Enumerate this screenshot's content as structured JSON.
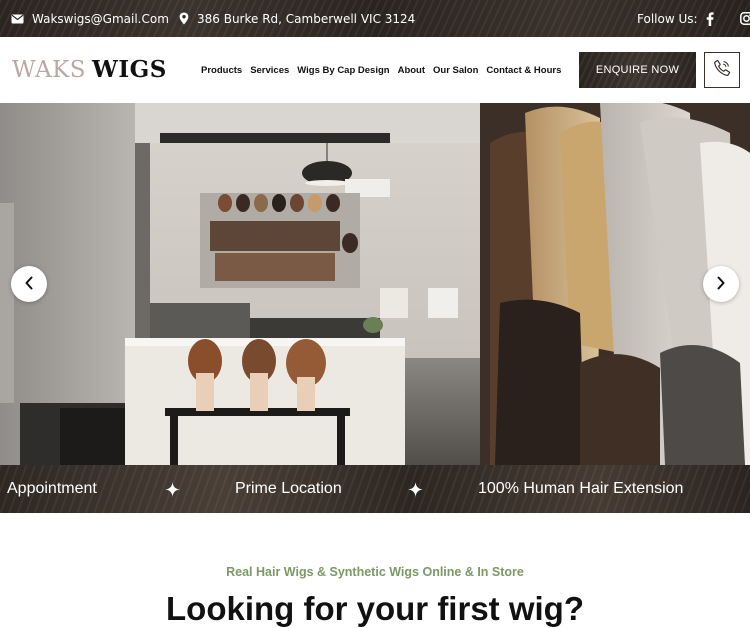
{
  "topbar": {
    "email": "Wakswigs@Gmail.Com",
    "address": "386 Burke Rd, Camberwell VIC 3124",
    "follow_label": "Follow Us:",
    "social": [
      "facebook-icon",
      "instagram-icon"
    ]
  },
  "header": {
    "logo_light": "WAKS",
    "logo_dark": "WIGS",
    "nav": [
      "Products",
      "Services",
      "Wigs By Cap Design",
      "About",
      "Our Salon",
      "Contact & Hours"
    ],
    "cta_label": "ENQUIRE NOW",
    "phone_icon": "phone-icon"
  },
  "hero": {
    "prev_icon": "chevron-left-icon",
    "next_icon": "chevron-right-icon"
  },
  "features": {
    "items": [
      "Appointment",
      "Prime Location",
      "100% Human Hair Extension"
    ],
    "separator_icon": "sparkle-icon"
  },
  "intro": {
    "subtitle": "Real Hair Wigs & Synthetic Wigs Online & In Store",
    "headline": "Looking for your first wig?"
  },
  "colors": {
    "dark_brown": "#2e2722",
    "accent_green": "#7d9766",
    "logo_light": "#b8aaa3"
  }
}
